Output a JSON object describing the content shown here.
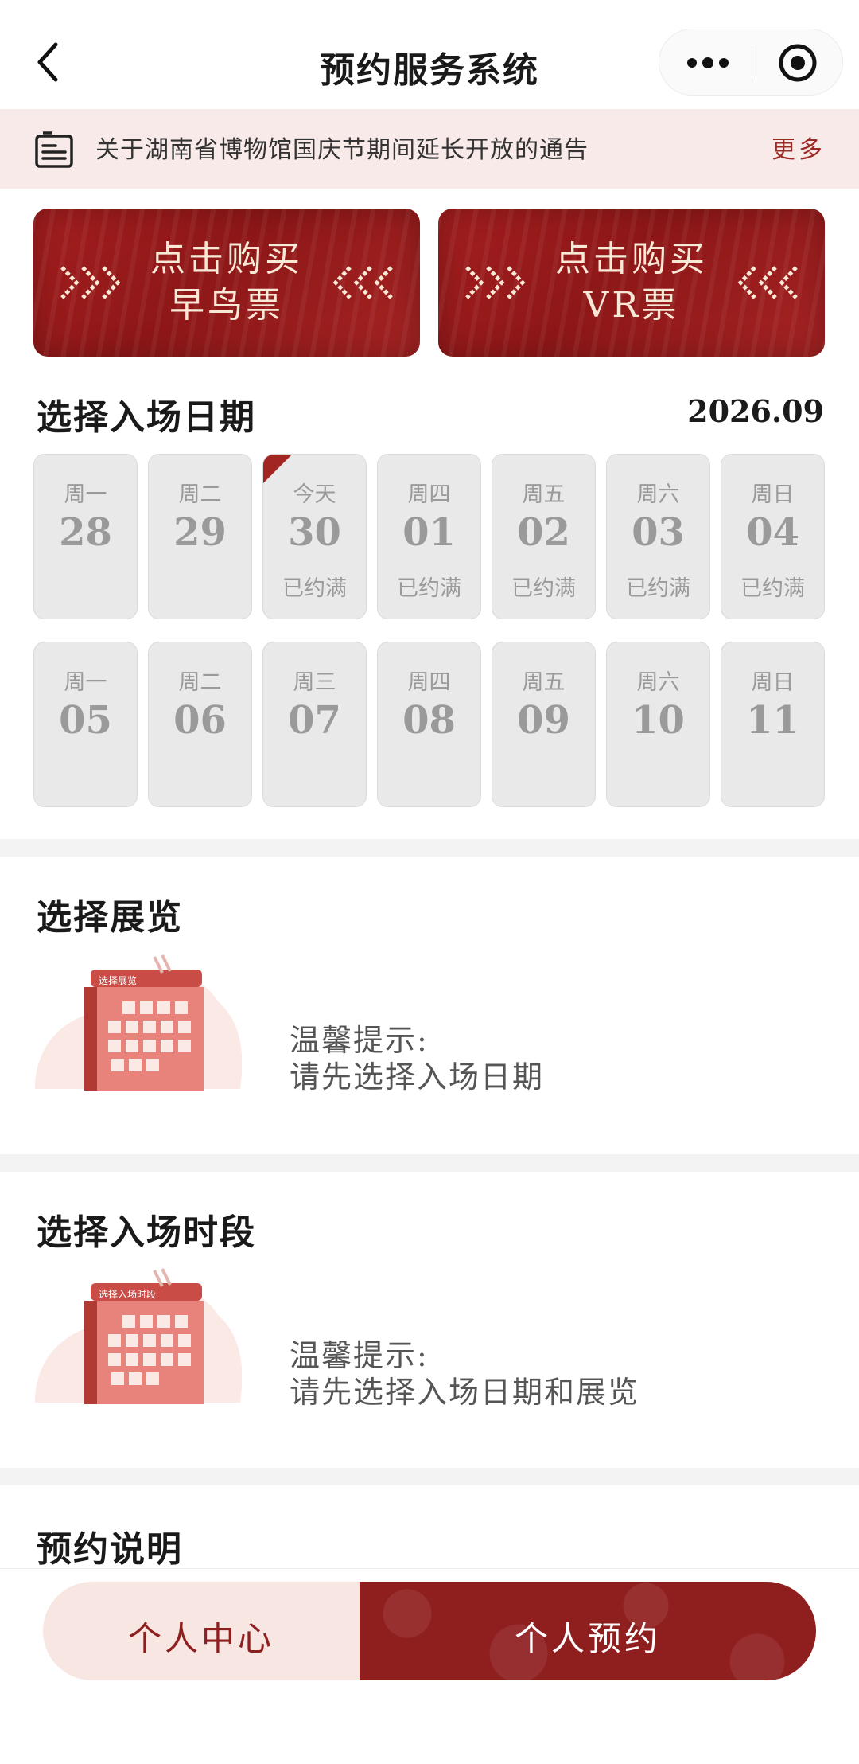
{
  "header": {
    "title": "预约服务系统"
  },
  "notice": {
    "text": "关于湖南省博物馆国庆节期间延长开放的通告",
    "more": "更多"
  },
  "banners": [
    {
      "line1": "点击购买",
      "line2": "早鸟票"
    },
    {
      "line1": "点击购买",
      "line2": "VR票"
    }
  ],
  "date_section": {
    "title": "选择入场日期",
    "month": "2026.09",
    "days": [
      {
        "week": "周一",
        "day": "28",
        "status": ""
      },
      {
        "week": "周二",
        "day": "29",
        "status": ""
      },
      {
        "week": "今天",
        "day": "30",
        "status": "已约满"
      },
      {
        "week": "周四",
        "day": "01",
        "status": "已约满"
      },
      {
        "week": "周五",
        "day": "02",
        "status": "已约满"
      },
      {
        "week": "周六",
        "day": "03",
        "status": "已约满"
      },
      {
        "week": "周日",
        "day": "04",
        "status": "已约满"
      },
      {
        "week": "周一",
        "day": "05",
        "status": ""
      },
      {
        "week": "周二",
        "day": "06",
        "status": ""
      },
      {
        "week": "周三",
        "day": "07",
        "status": ""
      },
      {
        "week": "周四",
        "day": "08",
        "status": ""
      },
      {
        "week": "周五",
        "day": "09",
        "status": ""
      },
      {
        "week": "周六",
        "day": "10",
        "status": ""
      },
      {
        "week": "周日",
        "day": "11",
        "status": ""
      }
    ]
  },
  "exhibition_section": {
    "title": "选择展览",
    "illustration_label": "选择展览",
    "tip_title": "温馨提示:",
    "tip_text": "请先选择入场日期"
  },
  "timeslot_section": {
    "title": "选择入场时段",
    "illustration_label": "选择入场时段",
    "tip_title": "温馨提示:",
    "tip_text": "请先选择入场日期和展览"
  },
  "instructions_section": {
    "title": "预约说明"
  },
  "bottom_nav": {
    "left_label": "个人中心",
    "right_label": "个人预约"
  },
  "colors": {
    "accent": "#9b2a26",
    "card_bg": "#e9e9e9",
    "notice_bg": "#f8eae8"
  }
}
